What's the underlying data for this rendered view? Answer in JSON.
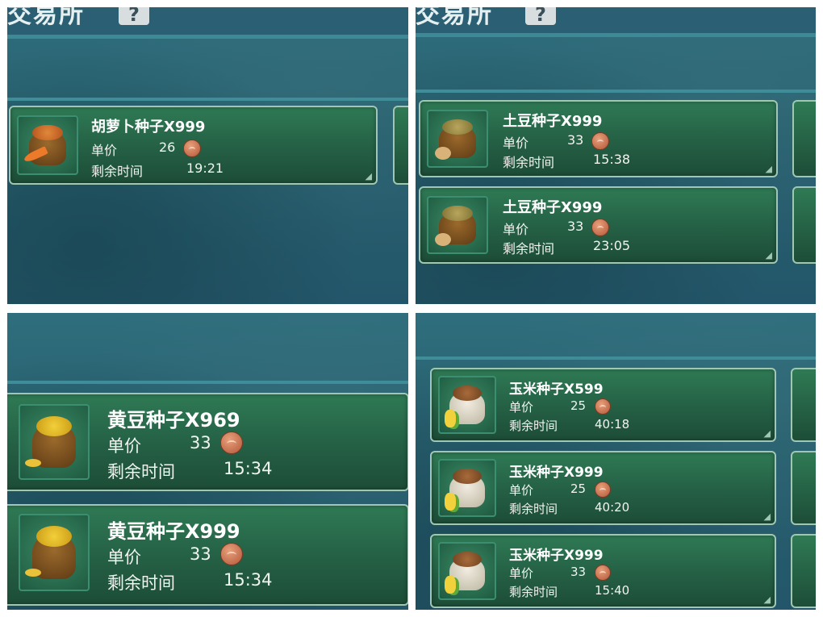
{
  "screen": {
    "title_fragment": "交易所",
    "help_label": "?"
  },
  "labels": {
    "unit_price": "单价",
    "time_left": "剩余时间"
  },
  "colors": {
    "card_green": "#2f7a55",
    "panel_teal": "#2b5f73",
    "coin": "#c86a48"
  },
  "panels": [
    {
      "listings": [
        {
          "name": "胡萝卜种子X999",
          "price": "26",
          "time": "19:21",
          "icon": "carrot-seed-bag-icon"
        }
      ]
    },
    {
      "listings": [
        {
          "name": "土豆种子X999",
          "price": "33",
          "time": "15:38",
          "icon": "potato-seed-bag-icon"
        },
        {
          "name": "土豆种子X999",
          "price": "33",
          "time": "23:05",
          "icon": "potato-seed-bag-icon"
        }
      ]
    },
    {
      "listings": [
        {
          "name": "黄豆种子X969",
          "price": "33",
          "time": "15:34",
          "icon": "soybean-seed-bag-icon"
        },
        {
          "name": "黄豆种子X999",
          "price": "33",
          "time": "15:34",
          "icon": "soybean-seed-bag-icon"
        }
      ]
    },
    {
      "listings": [
        {
          "name": "玉米种子X599",
          "price": "25",
          "time": "40:18",
          "icon": "corn-seed-bag-icon"
        },
        {
          "name": "玉米种子X999",
          "price": "25",
          "time": "40:20",
          "icon": "corn-seed-bag-icon"
        },
        {
          "name": "玉米种子X999",
          "price": "33",
          "time": "15:40",
          "icon": "corn-seed-bag-icon"
        }
      ]
    }
  ]
}
